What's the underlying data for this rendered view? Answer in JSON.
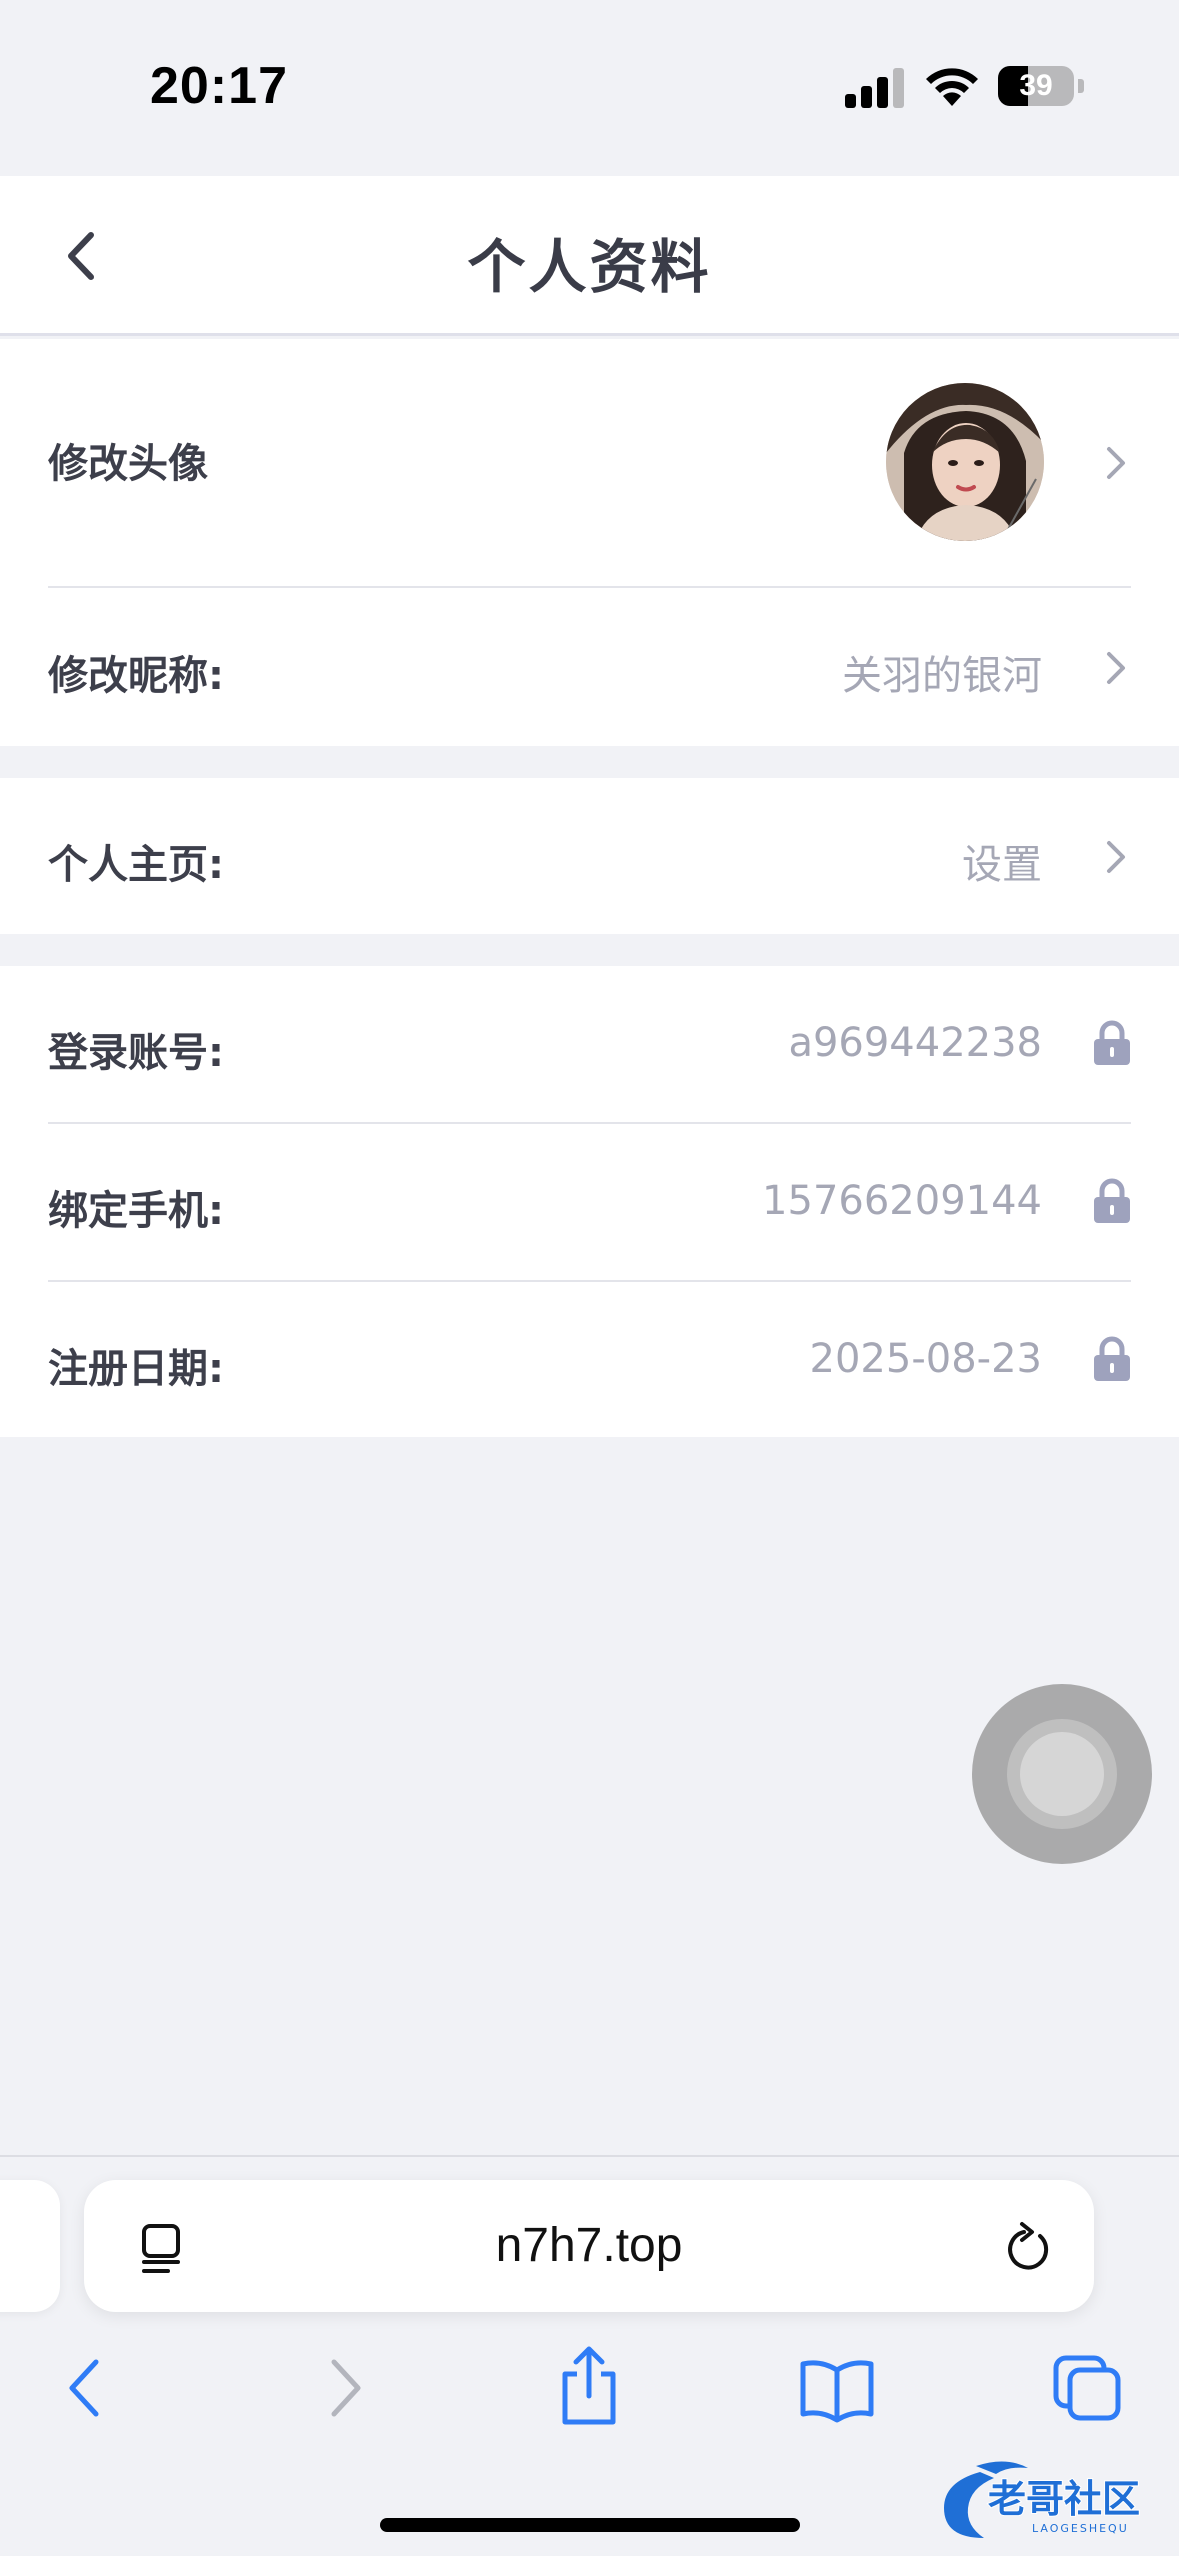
{
  "status_bar": {
    "time": "20:17",
    "battery": "39",
    "battery_level": 0.39,
    "icons": [
      "signal-icon",
      "wifi-icon",
      "battery-icon"
    ]
  },
  "header": {
    "title": "个人资料",
    "back_icon": "chevron-left-icon"
  },
  "profile": {
    "avatar_label": "修改头像",
    "nickname_label": "修改昵称:",
    "nickname_value": "关羽的银河"
  },
  "homepage": {
    "label": "个人主页:",
    "value": "设置"
  },
  "account": {
    "login_label": "登录账号:",
    "login_value": "a969442238",
    "phone_label": "绑定手机:",
    "phone_value": "15766209144",
    "register_label": "注册日期:",
    "register_value": "2025-08-23"
  },
  "browser": {
    "url": "n7h7.top",
    "toolbar_icons": [
      "back-icon",
      "forward-icon",
      "share-icon",
      "bookmarks-icon",
      "tabs-icon"
    ]
  },
  "watermark": {
    "text": "老哥社区",
    "subtext": "LAOGESHEQU"
  },
  "colors": {
    "background": "#f1f2f6",
    "card": "#ffffff",
    "label": "#3d3f4b",
    "value": "#a5a7b5",
    "lock": "#9ea2bd",
    "safari_blue": "#2f7cf6"
  }
}
